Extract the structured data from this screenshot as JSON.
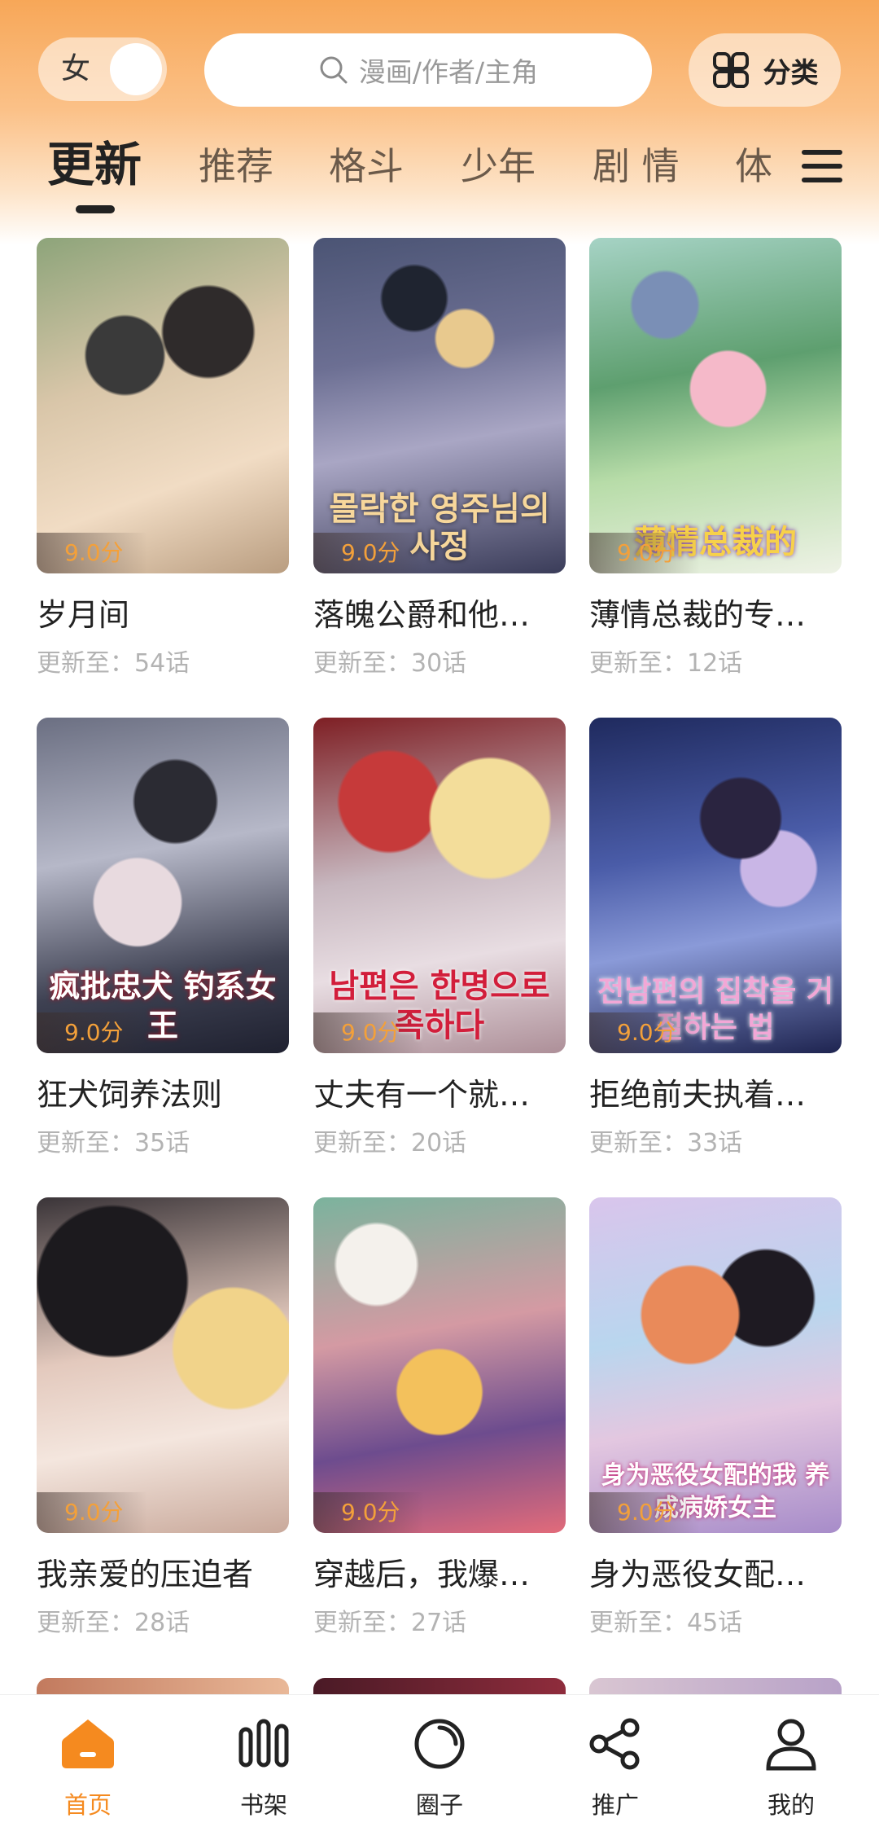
{
  "header": {
    "gender_label": "女",
    "search_placeholder": "漫画/作者/主角",
    "category_label": "分类",
    "search_icon": "search-icon",
    "category_icon": "grid-four-icon"
  },
  "tabs": [
    {
      "label": "更新",
      "active": true
    },
    {
      "label": "推荐",
      "active": false
    },
    {
      "label": "格斗",
      "active": false
    },
    {
      "label": "少年",
      "active": false
    },
    {
      "label": "剧 情",
      "active": false
    },
    {
      "label": "体",
      "active": false
    }
  ],
  "menu_icon": "hamburger-menu-icon",
  "comics": [
    {
      "title": "岁月间",
      "update": "更新至：54话",
      "score": "9.0分",
      "cover_text": ""
    },
    {
      "title": "落魄公爵和他…",
      "update": "更新至：30话",
      "score": "9.0分",
      "cover_text": "몰락한 영주님의 사정"
    },
    {
      "title": "薄情总裁的专…",
      "update": "更新至：12话",
      "score": "9.0分",
      "cover_text": "薄情总裁的"
    },
    {
      "title": "狂犬饲养法则",
      "update": "更新至：35话",
      "score": "9.0分",
      "cover_text": "疯批忠犬 钓系女王"
    },
    {
      "title": "丈夫有一个就…",
      "update": "更新至：20话",
      "score": "9.0分",
      "cover_text": "남편은 한명으로 족하다"
    },
    {
      "title": "拒绝前夫执着…",
      "update": "更新至：33话",
      "score": "9.0分",
      "cover_text": "전남편의 집착을 거절하는 법"
    },
    {
      "title": "我亲爱的压迫者",
      "update": "更新至：28话",
      "score": "9.0分",
      "cover_text": ""
    },
    {
      "title": "穿越后，我爆…",
      "update": "更新至：27话",
      "score": "9.0分",
      "cover_text": ""
    },
    {
      "title": "身为恶役女配…",
      "update": "更新至：45话",
      "score": "9.0分",
      "cover_text": "身为恶役女配的我 养成病娇女主"
    }
  ],
  "bottom_nav": [
    {
      "label": "首页",
      "icon": "home-icon",
      "active": true
    },
    {
      "label": "书架",
      "icon": "bookshelf-icon",
      "active": false
    },
    {
      "label": "圈子",
      "icon": "circle-community-icon",
      "active": false
    },
    {
      "label": "推广",
      "icon": "share-icon",
      "active": false
    },
    {
      "label": "我的",
      "icon": "profile-icon",
      "active": false
    }
  ],
  "colors": {
    "accent": "#f58a1f",
    "score": "#f3a03a",
    "header_top": "#f7a758"
  }
}
